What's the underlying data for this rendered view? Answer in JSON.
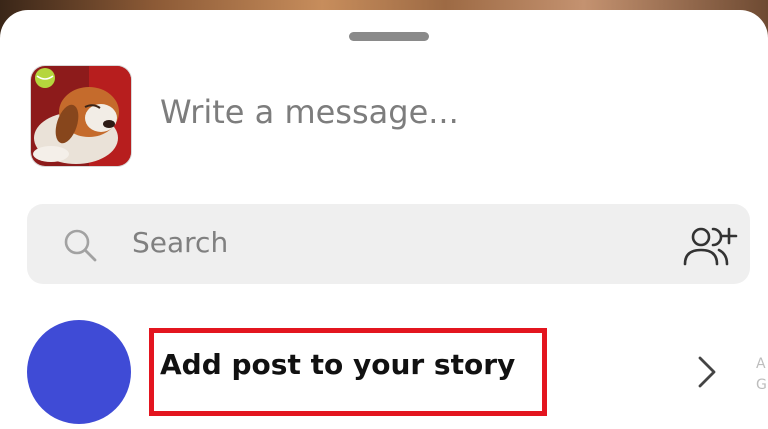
{
  "sheet": {
    "message_placeholder": "Write a message...",
    "thumbnail_icon": "puppy-photo-icon"
  },
  "search": {
    "placeholder": "Search",
    "search_icon": "search-icon",
    "add_icon": "add-people-icon"
  },
  "story_row": {
    "label": "Add post to your story",
    "edge_letters": "A\nG",
    "chevron_icon": "chevron-right-icon"
  },
  "colors": {
    "avatar": "#3f4bd6",
    "highlight": "#e3151f",
    "search_bg": "#efefef"
  }
}
